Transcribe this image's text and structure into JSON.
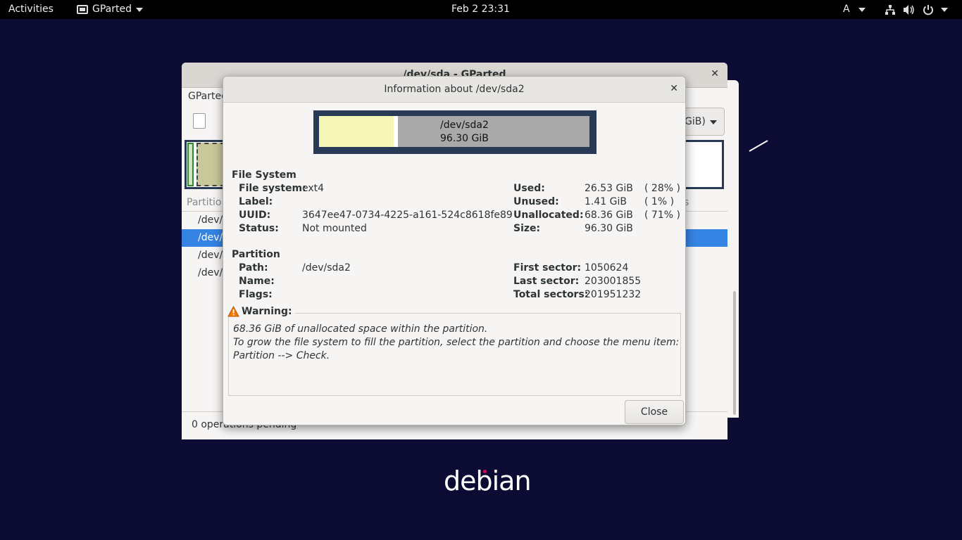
{
  "topbar": {
    "activities": "Activities",
    "app_name": "GParted",
    "clock": "Feb 2  23:31",
    "input_method": "A"
  },
  "background_window": {
    "title": "/dev/sda - GParted",
    "menu_text": "GParted",
    "device_selector": "GiB)",
    "column_header": "Partitio",
    "column_header_right": "s",
    "rows": [
      "/dev/s",
      "/dev/s",
      "/dev/s",
      "/dev/s"
    ],
    "status": "0 operations pending"
  },
  "dialog": {
    "title": "Information about /dev/sda2",
    "graph": {
      "path": "/dev/sda2",
      "size": "96.30 GiB",
      "used_fraction": 0.275,
      "unused_fraction": 0.015
    },
    "filesystem": {
      "section": "File System",
      "labels": {
        "file_system": "File system:",
        "label": "Label:",
        "uuid": "UUID:",
        "status": "Status:",
        "used": "Used:",
        "unused": "Unused:",
        "unallocated": "Unallocated:",
        "size": "Size:"
      },
      "values": {
        "file_system": "ext4",
        "label": "",
        "uuid": "3647ee47-0734-4225-a161-524c8618fe89",
        "status": "Not mounted",
        "used": "26.53 GiB",
        "used_pct": "( 28% )",
        "unused": "1.41 GiB",
        "unused_pct": "( 1% )",
        "unallocated": "68.36 GiB",
        "unallocated_pct": "( 71% )",
        "size": "96.30 GiB"
      }
    },
    "partition": {
      "section": "Partition",
      "labels": {
        "path": "Path:",
        "name": "Name:",
        "flags": "Flags:",
        "first_sector": "First sector:",
        "last_sector": "Last sector:",
        "total_sectors": "Total sectors:"
      },
      "values": {
        "path": "/dev/sda2",
        "name": "",
        "flags": "",
        "first_sector": "1050624",
        "last_sector": "203001855",
        "total_sectors": "201951232"
      }
    },
    "warning": {
      "label": "Warning:",
      "lines": [
        "68.36 GiB of unallocated space within the partition.",
        "To grow the file system to fill the partition, select the partition and choose the menu item:",
        "Partition --> Check."
      ]
    },
    "close_button": "Close"
  },
  "desktop": {
    "logo_text": "debian"
  },
  "colors": {
    "desktop_bg": "#0b0b33",
    "selection": "#3584e4",
    "used_fill": "#f5f5b8",
    "unallocated_fill": "#a9a9a9",
    "graph_border": "#283a55",
    "warning_icon": "#f57900"
  }
}
